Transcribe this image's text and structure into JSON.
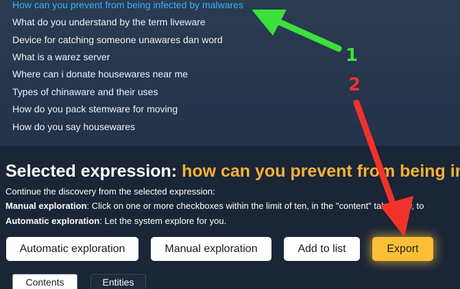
{
  "questions": [
    "How can you prevent from being infected by malwares",
    "What do you understand by the term liveware",
    "Device for catching someone unawares dan word",
    "What is a warez server",
    "Where can i donate housewares near me",
    "Types of chinaware and their uses",
    "How do you pack stemware for moving",
    "How do you say housewares"
  ],
  "selected": {
    "label": "Selected expression: ",
    "expression": "how can you prevent from being in"
  },
  "info": {
    "intro": "Continue the discovery from the selected expression:",
    "manual_label": "Manual exploration",
    "manual_text": ": Click on one or more checkboxes within the limit of ten, in the \"content\" tab below, to",
    "auto_label": "Automatic exploration",
    "auto_text": ": Let the system explore for you."
  },
  "buttons": {
    "automatic": "Automatic exploration",
    "manual": "Manual exploration",
    "add": "Add to list",
    "export": "Export"
  },
  "tabs": {
    "contents": "Contents",
    "entities": "Entities"
  },
  "annotations": {
    "one": "1",
    "two": "2"
  },
  "colors": {
    "active_link": "#33b4ff",
    "highlight_orange": "#f7b233",
    "export_button": "#fbbf37",
    "arrow_green": "#3de03d",
    "arrow_red": "#f0322a"
  }
}
